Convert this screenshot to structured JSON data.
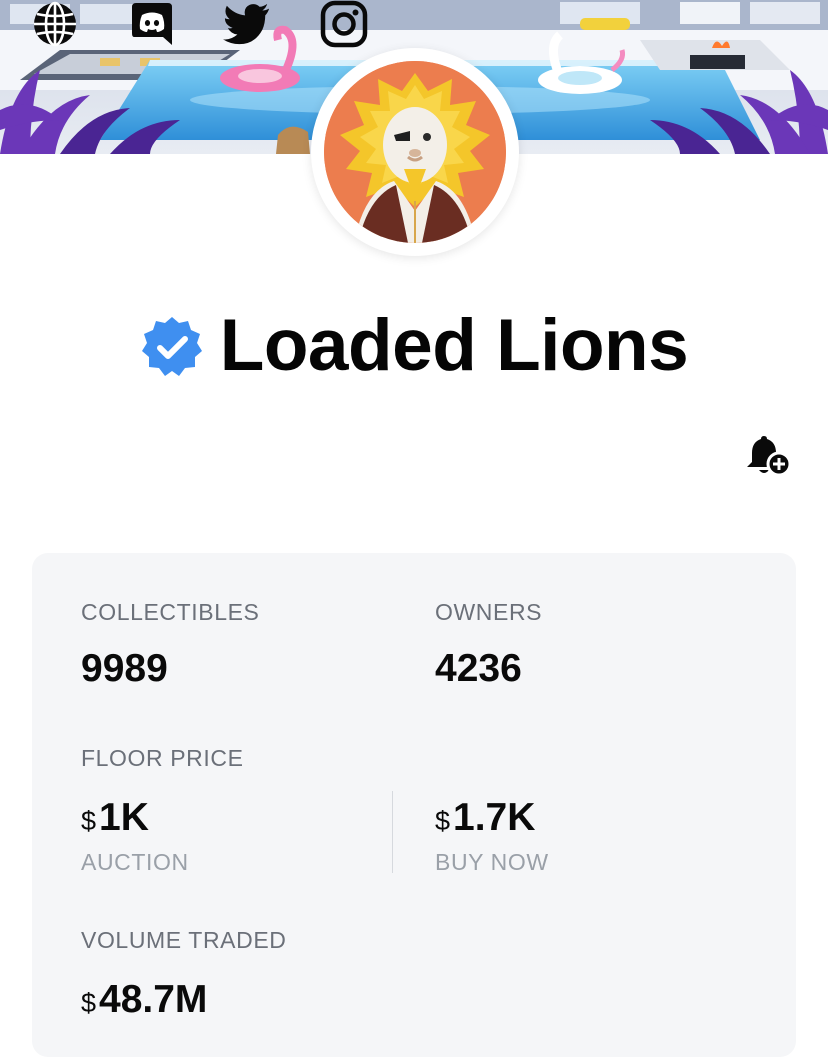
{
  "collection": {
    "name": "Loaded Lions",
    "verified": true
  },
  "social_links": [
    "globe-icon",
    "discord-icon",
    "twitter-icon",
    "instagram-icon"
  ],
  "notify": {
    "icon": "bell-plus-icon"
  },
  "stats": {
    "collectibles_label": "COLLECTIBLES",
    "collectibles_value": "9989",
    "owners_label": "OWNERS",
    "owners_value": "4236",
    "floor_price_label": "FLOOR PRICE",
    "auction_currency": "$",
    "auction_value": "1K",
    "auction_label": "AUCTION",
    "buy_now_currency": "$",
    "buy_now_value": "1.7K",
    "buy_now_label": "BUY NOW",
    "volume_label": "VOLUME TRADED",
    "volume_currency": "$",
    "volume_value": "48.7M"
  },
  "colors": {
    "verified_badge": "#3f8ff0",
    "avatar_bg": "#ec7d4e",
    "card_bg": "#f5f6f8",
    "label_text": "#6b7079",
    "sub_label_text": "#9aa0a8"
  }
}
